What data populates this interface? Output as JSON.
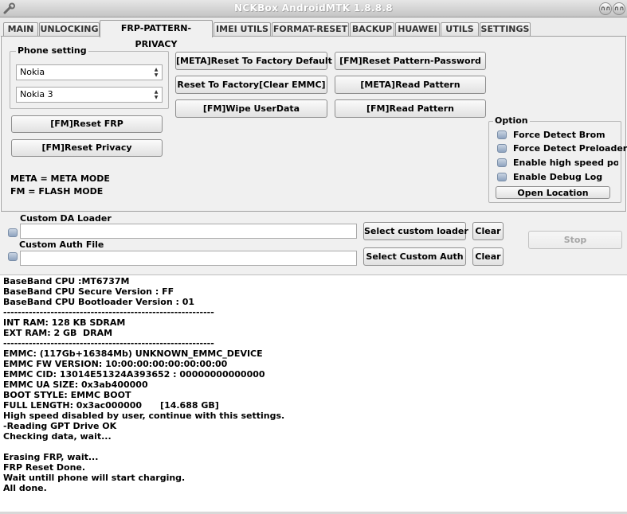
{
  "window": {
    "title": "NCKBox AndroidMTK 1.8.8.8",
    "icon": "wrench-icon",
    "controls": [
      "restore-icon",
      "close-icon"
    ]
  },
  "tabs": [
    {
      "label": "MAIN",
      "active": false
    },
    {
      "label": "UNLOCKING",
      "active": false
    },
    {
      "label": "FRP-PATTERN-PRIVACY",
      "active": true
    },
    {
      "label": "IMEI UTILS",
      "active": false
    },
    {
      "label": "FORMAT-RESET",
      "active": false
    },
    {
      "label": "BACKUP",
      "active": false
    },
    {
      "label": "HUAWEI",
      "active": false
    },
    {
      "label": "UTILS",
      "active": false
    },
    {
      "label": "SETTINGS",
      "active": false
    }
  ],
  "phone_setting": {
    "legend": "Phone setting",
    "brand": "Nokia",
    "model": "Nokia 3"
  },
  "buttons": {
    "fm_reset_frp": "[FM]Reset FRP",
    "fm_reset_privacy": "[FM]Reset Privacy",
    "meta_reset_factory_default": "[META]Reset To Factory Default",
    "reset_factory_clear_emmc": "Reset To Factory[Clear EMMC]",
    "fm_wipe_userdata": "[FM]Wipe UserData",
    "fm_reset_pattern_password": "[FM]Reset Pattern-Password",
    "meta_read_pattern": "[META]Read Pattern",
    "fm_read_pattern": "[FM]Read Pattern",
    "open_location": "Open Location",
    "select_custom_loader": "Select custom loader",
    "clear_loader": "Clear",
    "select_custom_auth": "Select Custom Auth",
    "clear_auth": "Clear",
    "stop": "Stop"
  },
  "legend_text": {
    "meta": "META = META MODE",
    "fm": "FM = FLASH MODE"
  },
  "options": {
    "legend": "Option",
    "items": [
      {
        "label": "Force Detect Brom",
        "checked": false
      },
      {
        "label": "Force Detect Preloader",
        "checked": false
      },
      {
        "label": "Enable high speed port",
        "checked": false
      },
      {
        "label": "Enable Debug Log",
        "checked": false
      }
    ]
  },
  "custom": {
    "da_loader_label": "Custom DA Loader",
    "da_loader_value": "",
    "auth_file_label": "Custom Auth File",
    "auth_file_value": ""
  },
  "log": [
    "BaseBand CPU :MT6737M",
    "BaseBand CPU Secure Version : FF",
    "BaseBand CPU Bootloader Version : 01",
    "----------------------------------------------------------",
    "INT RAM: 128 KB SDRAM",
    "EXT RAM: 2 GB  DRAM",
    "----------------------------------------------------------",
    "EMMC: (117Gb+16384Mb) UNKNOWN_EMMC_DEVICE",
    "EMMC FW VERSION: 10:00:00:00:00:00:00:00",
    "EMMC CID: 13014E51324A393652 : 00000000000000",
    "EMMC UA SIZE: 0x3ab400000",
    "BOOT STYLE: EMMC BOOT",
    "FULL LENGTH: 0x3ac000000      [14.688 GB]",
    "High speed disabled by user, continue with this settings.",
    "-Reading GPT Drive OK",
    "Checking data, wait...",
    "",
    "Erasing FRP, wait...",
    "FRP Reset Done.",
    "Wait untill phone will start charging.",
    "All done."
  ]
}
